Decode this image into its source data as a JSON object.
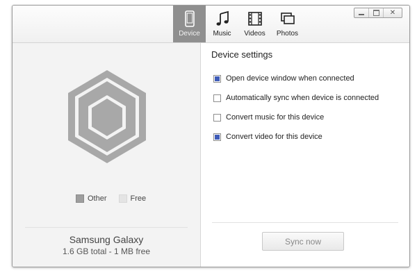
{
  "window_controls": {
    "minimize_icon": "minimize-icon",
    "maximize_icon": "maximize-icon",
    "close_label": "✕"
  },
  "tabs": [
    {
      "label": "Device",
      "icon": "phone-icon",
      "active": true
    },
    {
      "label": "Music",
      "icon": "music-note-icon",
      "active": false
    },
    {
      "label": "Videos",
      "icon": "film-icon",
      "active": false
    },
    {
      "label": "Photos",
      "icon": "photos-icon",
      "active": false
    }
  ],
  "storage": {
    "legend": [
      {
        "label": "Other",
        "color": "#9e9e9e"
      },
      {
        "label": "Free",
        "color": "#e4e4e4"
      }
    ]
  },
  "device": {
    "name": "Samsung Galaxy",
    "info": "1.6 GB total - 1 MB free"
  },
  "settings": {
    "title": "Device settings",
    "options": [
      {
        "label": "Open device window when connected",
        "checked": true
      },
      {
        "label": "Automatically sync when device is connected",
        "checked": false
      },
      {
        "label": "Convert music for this device",
        "checked": false
      },
      {
        "label": "Convert video for this device",
        "checked": true
      }
    ]
  },
  "actions": {
    "sync_label": "Sync now"
  },
  "colors": {
    "active_tab": "#8f8f8f",
    "checkbox_check": "#3f5cb8",
    "hex_fill": "#a8a8a8"
  }
}
